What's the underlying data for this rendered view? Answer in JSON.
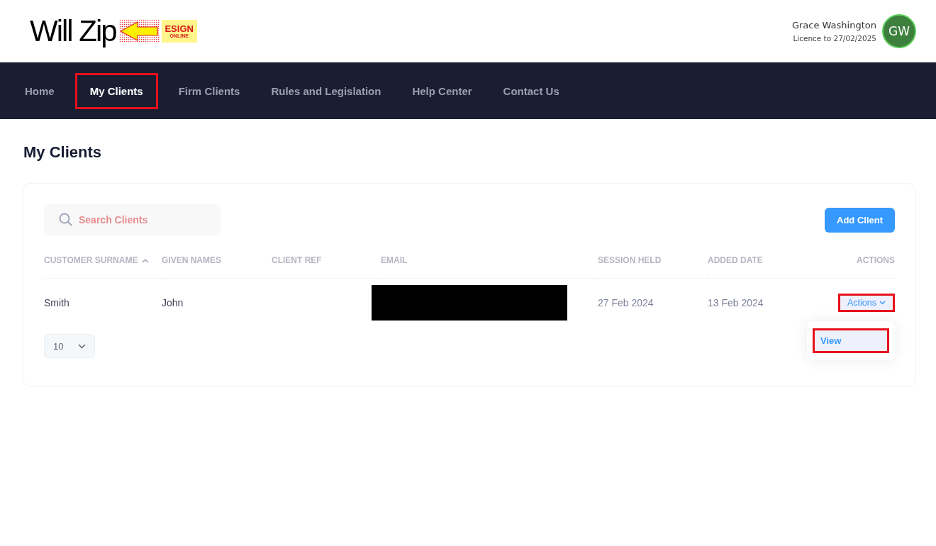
{
  "header": {
    "logo": {
      "wordmark": "Will Zip",
      "badge_top": "ESIGN",
      "badge_bottom": "ONLINE"
    },
    "user": {
      "name": "Grace Washington",
      "licence": "Licence to 27/02/2025",
      "initials": "GW"
    }
  },
  "nav": [
    {
      "label": "Home",
      "selected": false,
      "highlighted": false
    },
    {
      "label": "My Clients",
      "selected": true,
      "highlighted": true
    },
    {
      "label": "Firm Clients",
      "selected": false,
      "highlighted": false
    },
    {
      "label": "Rules and Legislation",
      "selected": false,
      "highlighted": false
    },
    {
      "label": "Help Center",
      "selected": false,
      "highlighted": false
    },
    {
      "label": "Contact Us",
      "selected": false,
      "highlighted": false
    }
  ],
  "page_title": "My Clients",
  "search": {
    "placeholder": "Search Clients"
  },
  "add_button": "Add Client",
  "table": {
    "columns": [
      {
        "label": "CUSTOMER SURNAME",
        "sorted": true
      },
      {
        "label": "GIVEN NAMES",
        "sorted": false
      },
      {
        "label": "CLIENT REF",
        "sorted": false
      },
      {
        "label": "EMAIL",
        "sorted": false
      },
      {
        "label": "SESSION HELD",
        "sorted": false
      },
      {
        "label": "ADDED DATE",
        "sorted": false
      },
      {
        "label": "ACTIONS",
        "sorted": false
      }
    ],
    "rows": [
      {
        "surname": "Smith",
        "given_names": "John",
        "email_redacted": true,
        "session_held": "27 Feb 2024",
        "added_date": "13 Feb 2024",
        "actions": {
          "label": "Actions",
          "highlighted": true,
          "expanded": true,
          "menu": [
            {
              "label": "View",
              "highlighted": true
            }
          ]
        }
      }
    ]
  },
  "page_size": "10"
}
